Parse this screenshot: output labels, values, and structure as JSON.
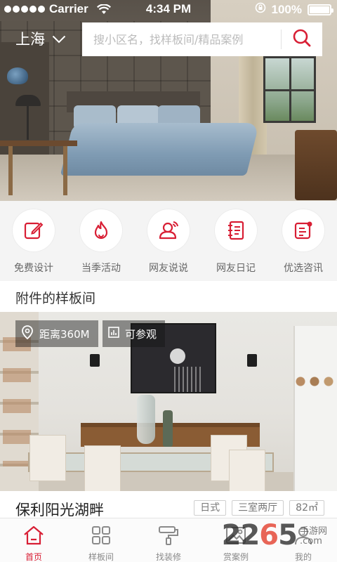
{
  "status_bar": {
    "carrier": "Carrier",
    "time": "4:34 PM",
    "battery_percent": "100%",
    "battery_level": 1.0
  },
  "header": {
    "city": "上海",
    "search_placeholder": "搜小区名，找样板间/精品案例"
  },
  "quick_actions": [
    {
      "label": "免费设计",
      "icon": "pencil-note-icon"
    },
    {
      "label": "当季活动",
      "icon": "flame-icon"
    },
    {
      "label": "网友说说",
      "icon": "person-chat-icon"
    },
    {
      "label": "网友日记",
      "icon": "notebook-icon"
    },
    {
      "label": "优选咨讯",
      "icon": "news-doc-icon"
    }
  ],
  "section": {
    "title": "附件的样板间"
  },
  "card": {
    "distance": "距离360M",
    "status": "可参观",
    "title": "保利阳光湖畔",
    "tags": [
      "日式",
      "三室两厅",
      "82㎡"
    ]
  },
  "tabbar": {
    "items": [
      {
        "label": "首页",
        "icon": "home-icon",
        "active": true
      },
      {
        "label": "样板间",
        "icon": "grid-icon",
        "active": false
      },
      {
        "label": "找装修",
        "icon": "paint-roller-icon",
        "active": false
      },
      {
        "label": "赏案例",
        "icon": "image-icon",
        "active": false
      },
      {
        "label": "我的",
        "icon": "user-icon",
        "active": false
      }
    ]
  },
  "watermark": {
    "brand": "2265",
    "suffix": ".com",
    "line1": "手游网",
    "line2": ""
  },
  "colors": {
    "accent": "#d81e34",
    "background": "#f4f4f4"
  }
}
